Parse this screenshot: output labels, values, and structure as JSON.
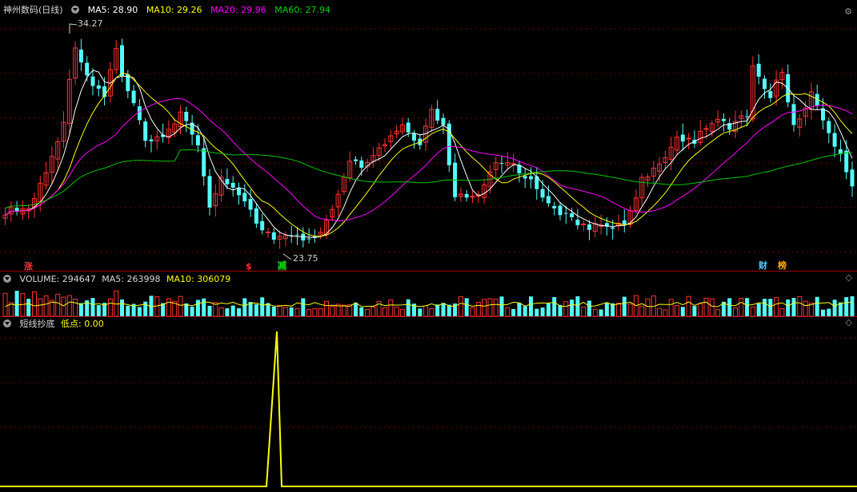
{
  "main": {
    "stock_name": "神州数码(日线)",
    "ma5_label": "MA5: 28.90",
    "ma10_label": "MA10: 29.26",
    "ma20_label": "MA20: 29.96",
    "ma60_label": "MA60: 27.94",
    "high_label": "34.27",
    "low_label": "23.75",
    "marker_zhang": "涨",
    "marker_s": "$",
    "marker_jian": "减",
    "marker_cai": "财",
    "marker_bang": "榜"
  },
  "volume": {
    "vol_label": "VOLUME: 294647",
    "ma5_label": "MA5: 263998",
    "ma10_label": "MA10: 306079"
  },
  "indicator": {
    "name": "短线抄底",
    "low_point_label": "低点: 0.00"
  },
  "icons": {
    "settings": "settings-icon",
    "diamond": "diamond-icon",
    "collapse": "triangle-down-icon"
  },
  "colors": {
    "up": "#ff3232",
    "down": "#54fcfc",
    "ma5": "#ffffff",
    "ma10": "#ffff00",
    "ma20": "#ff00ff",
    "ma60": "#00c800",
    "grid": "#6e0000",
    "signal": "#ffff00"
  }
}
